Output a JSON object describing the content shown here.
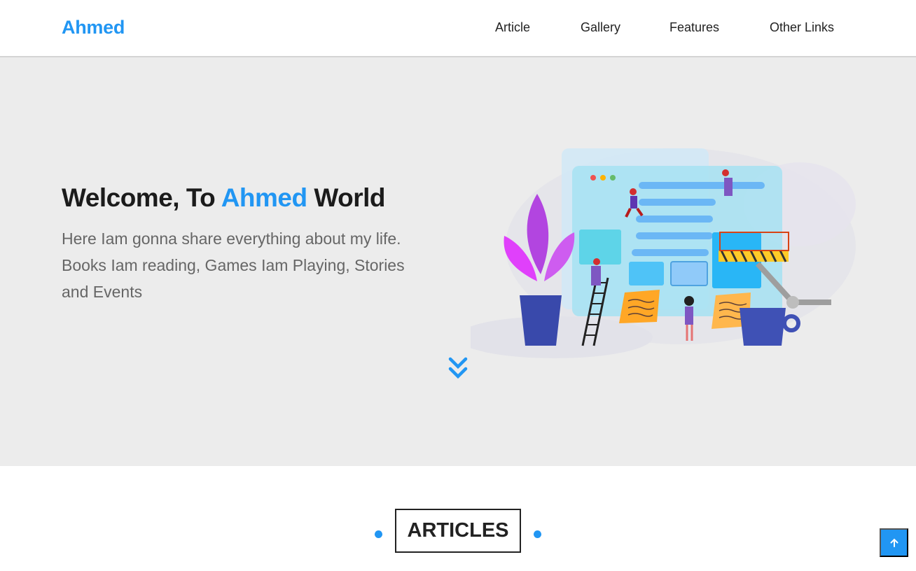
{
  "header": {
    "logo": "Ahmed",
    "nav": [
      "Article",
      "Gallery",
      "Features",
      "Other Links"
    ]
  },
  "hero": {
    "title_part1": "Welcome, To ",
    "title_accent": "Ahmed",
    "title_part2": " World",
    "description": "Here Iam gonna share everything about my life. Books Iam reading, Games Iam Playing, Stories and Events",
    "scroll_icon": "double-chevron-down-icon"
  },
  "articles": {
    "heading": "ARTICLES"
  },
  "controls": {
    "to_top_icon": "arrow-up-icon"
  },
  "colors": {
    "accent": "#2196f3",
    "hero_bg": "#ececec",
    "text_dark": "#1b1b1b",
    "text_muted": "#666666"
  }
}
